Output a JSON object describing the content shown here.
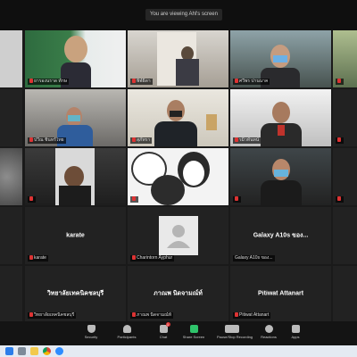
{
  "window": {
    "title": "You are viewing Ahl's screen"
  },
  "tiles": [
    {
      "name": "ยารองนราด ทักษ"
    },
    {
      "name": "พิพ์ธิดา"
    },
    {
      "name": "ศวีพร ปานนาค"
    },
    {
      "name": ""
    },
    {
      "name": "ปวีณ ชินทร์ไทย"
    },
    {
      "name": "สุภัทรา"
    },
    {
      "name": "รมิ่วทันทน์"
    },
    {
      "name": ""
    },
    {
      "name": ""
    },
    {
      "name": ""
    },
    {
      "name": ""
    },
    {
      "name": ""
    },
    {
      "center": "karate",
      "name": "karate"
    },
    {
      "name": "Charintorn Ayphur"
    },
    {
      "center": "Galaxy A10s ของ...",
      "name": "Galaxy A10s ของ..."
    },
    {
      "center": "วิทยาลัยเทคนิคชลบุรี",
      "name": "วิทยาลัยเทคนิคชลบุรี"
    },
    {
      "center": "ภาณพ นิดจามณ์ท์",
      "name": "ภาณพ นิดจามณ์ท์"
    },
    {
      "center": "Pitiwat Attanart",
      "name": "Pitiwat Attanart"
    }
  ],
  "toolbar": [
    {
      "label": "Security",
      "icon": "shield-icon",
      "color": "#bbbbbb"
    },
    {
      "label": "Participants",
      "icon": "participants-icon",
      "color": "#bbbbbb"
    },
    {
      "label": "Chat",
      "icon": "chat-icon",
      "color": "#bbbbbb",
      "badge": "1"
    },
    {
      "label": "Share Screen",
      "icon": "share-screen-icon",
      "color": "#2fc46b"
    },
    {
      "label": "Pause/Stop Recording",
      "icon": "recording-icon",
      "color": "#bbbbbb"
    },
    {
      "label": "Reactions",
      "icon": "reactions-icon",
      "color": "#bbbbbb"
    },
    {
      "label": "Apps",
      "icon": "apps-icon",
      "color": "#bbbbbb"
    }
  ]
}
